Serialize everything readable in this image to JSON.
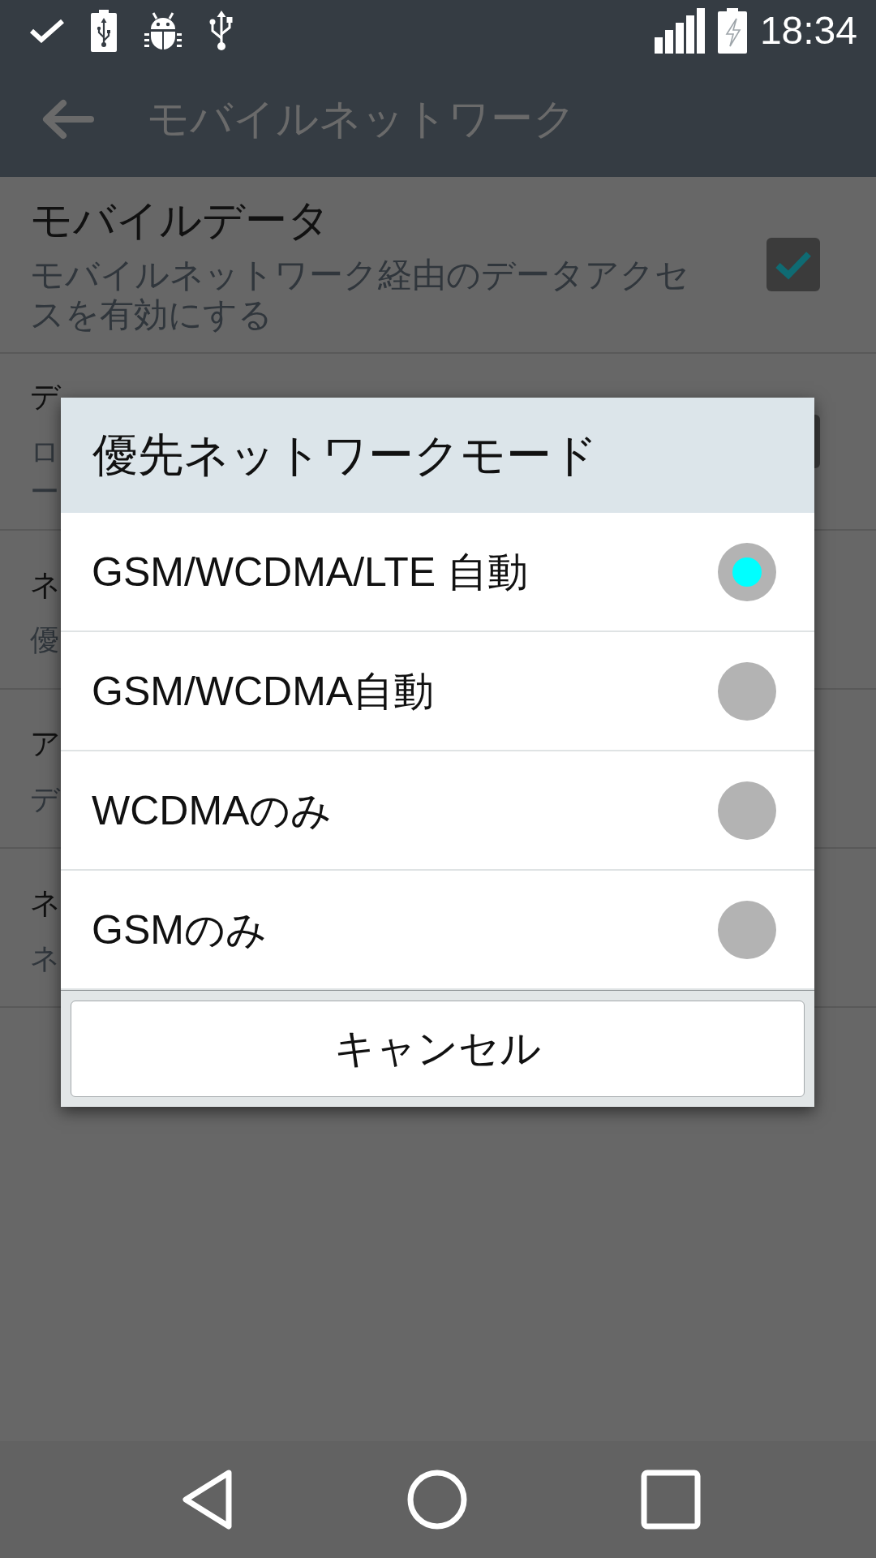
{
  "status_bar": {
    "time": "18:34"
  },
  "app_bar": {
    "title": "モバイルネットワーク"
  },
  "settings": [
    {
      "kind": "checkbox_row",
      "title": "モバイルデータ",
      "summary": "モバイルネットワーク経由のデータアクセスを有効にする",
      "checked": true
    },
    {
      "kind": "covered_checkbox_row",
      "title": "デ",
      "summary_lines": [
        "ロ",
        "ー"
      ]
    },
    {
      "kind": "covered_row",
      "title": "ネ",
      "summary_lines": [
        "優"
      ]
    },
    {
      "kind": "covered_row",
      "title": "ア",
      "summary_lines": [
        "デ"
      ]
    },
    {
      "kind": "covered_row",
      "title": "ネ",
      "summary_lines": [
        "ネ"
      ]
    }
  ],
  "dialog": {
    "title": "優先ネットワークモード",
    "options": [
      {
        "label": "GSM/WCDMA/LTE 自動",
        "selected": true
      },
      {
        "label": "GSM/WCDMA自動",
        "selected": false
      },
      {
        "label": "WCDMAのみ",
        "selected": false
      },
      {
        "label": "GSMのみ",
        "selected": false
      }
    ],
    "cancel_button": "キャンセル"
  }
}
